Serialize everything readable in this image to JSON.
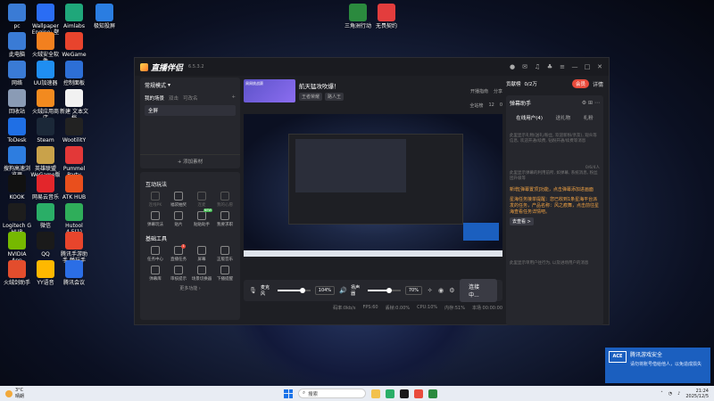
{
  "desktop_icons": [
    {
      "label": "pc",
      "color": "#3a7bd5"
    },
    {
      "label": "此电脑",
      "color": "#3a7bd5"
    },
    {
      "label": "网络",
      "color": "#3a7bd5"
    },
    {
      "label": "回收站",
      "color": "#8a9bb5"
    },
    {
      "label": "ToDesk",
      "color": "#1f6fe5"
    },
    {
      "label": "搜狗高速浏览器",
      "color": "#2d7de0"
    },
    {
      "label": "KOOK",
      "color": "#111111"
    },
    {
      "label": "Logitech G HUB",
      "color": "#1d1d1d"
    },
    {
      "label": "NVIDIA App",
      "color": "#76b900"
    },
    {
      "label": "火绒剑助手",
      "color": "#e34d2d"
    },
    {
      "label": "Wallpaper Engine: 壁纸引擎",
      "color": "#2a6df4"
    },
    {
      "label": "火绒安全软件",
      "color": "#f2801f"
    },
    {
      "label": "UU加速器",
      "color": "#1f8ef1"
    },
    {
      "label": "火绒应用商店",
      "color": "#f28a1f"
    },
    {
      "label": "Steam",
      "color": "#1b2838"
    },
    {
      "label": "英雄联盟 WeGame版",
      "color": "#c9a24a"
    },
    {
      "label": "网易云音乐",
      "color": "#e3262b"
    },
    {
      "label": "微信",
      "color": "#2aae67"
    },
    {
      "label": "QQ",
      "color": "#1a1a1a"
    },
    {
      "label": "YY语音",
      "color": "#ffb800"
    },
    {
      "label": "Aimlabs",
      "color": "#1fa77a"
    },
    {
      "label": "WeGame",
      "color": "#e8442d"
    },
    {
      "label": "控制面板",
      "color": "#2d6fd6"
    },
    {
      "label": "新建 文本文档",
      "color": "#f1f1f1"
    },
    {
      "label": "WootilitY",
      "color": "#222222"
    },
    {
      "label": "Pummel Party",
      "color": "#e33838"
    },
    {
      "label": "ATK HUB",
      "color": "#e94f1d"
    },
    {
      "label": "Hutool 4.5(1)",
      "color": "#2fae5a"
    },
    {
      "label": "腾讯手游助手 畅玩手机...",
      "color": "#e8452c"
    },
    {
      "label": "腾讯会议",
      "color": "#2b6ee6"
    },
    {
      "label": "极知投屏",
      "color": "#2a7de1"
    },
    {
      "label": "三角洲行动",
      "color": "#2b8a3e"
    },
    {
      "label": "无畏契约",
      "color": "#e33d3d"
    }
  ],
  "app": {
    "title": "直播伴侣",
    "version": "6.5.3.2",
    "vip_label": "会员",
    "details_label": "详情",
    "left": {
      "mode_label": "常规模式",
      "horizontal": "横屏",
      "vertical": "竖屏",
      "tabs": [
        "我的场景",
        "双击",
        "可改名"
      ],
      "scene": "全屏",
      "add_source": "添加素材",
      "interact_title": "互动玩法",
      "interact_items": [
        {
          "label": "连线PK",
          "dim": true
        },
        {
          "label": "福袋抽奖",
          "dim": false
        },
        {
          "label": "连麦",
          "dim": true
        },
        {
          "label": "我的心愿",
          "dim": true
        },
        {
          "label": "弹幕玩法",
          "dim": false
        },
        {
          "label": "贴片",
          "dim": false
        },
        {
          "label": "贴贴助手",
          "dim": false,
          "badge": "NEW"
        },
        {
          "label": "我要求职",
          "dim": false
        }
      ],
      "tools_title": "基础工具",
      "tool_items": [
        {
          "label": "任务中心",
          "badge": ""
        },
        {
          "label": "直播任务",
          "badge": "1"
        },
        {
          "label": "屏幕",
          "badge": ""
        },
        {
          "label": "正版音乐",
          "badge": ""
        },
        {
          "label": "弹幕库",
          "badge": ""
        },
        {
          "label": "审核提示",
          "badge": ""
        },
        {
          "label": "场景切换器",
          "badge": ""
        },
        {
          "label": "下播提醒",
          "badge": ""
        }
      ],
      "more": "更多功能"
    },
    "center": {
      "banner_img_text": "周周挑战赛",
      "banner_title": "航天猛攻吹爆！",
      "tags": [
        "王者荣耀",
        "路人王"
      ],
      "actions": [
        "开播指南",
        "分享"
      ],
      "stats": [
        "全站榜",
        "12",
        "0"
      ],
      "mic_label": "麦克风",
      "mic_pct": "104%",
      "speaker_label": "扬声器",
      "speaker_pct": "70%",
      "mic_level": 0.7,
      "speaker_level": 0.6,
      "tool_labels": [
        "美颜",
        "录制",
        "设置"
      ],
      "connect": "连接中...",
      "status": [
        "码率:0kb/s",
        "FPS:60",
        "丢帧:0.00%",
        "CPU:10%",
        "内存:51%",
        "本场 00:00:00"
      ]
    },
    "right": {
      "account": "贡献榜",
      "fans": "0/2万",
      "pay_label": "打赏",
      "danmu_title": "弹幕助手",
      "danmu_tabs": [
        "在线用户(4)",
        "送礼物",
        "礼粉"
      ],
      "danmu_hint1": "此里显示礼物(送礼/粉丝, 欢迎新粉/亲友), 观众等信息, 欢迎开通/续费, 钻粉开通/续费等消息",
      "danmu_hint2": "此里显示弹幕的利用前所, 如弹幕, 系统消息, 粉丝团升级等",
      "notice": "新增[弹幕置顶]功能，点击弹幕添加进画面",
      "notice2": "星海任务接单提醒：您已收到1条星海平台派发的任务，产品名称：风之痕舞，点击前往星海查看任务详情吧。",
      "notice_link": "去查看 >",
      "danmu_hint3": "此里显示单用户往行为, 以及进场用户的消息",
      "count_label": "0/6/4人"
    }
  },
  "toast": {
    "brand": "ACE",
    "title": "腾讯游戏安全",
    "text": "请勿将账号借给他人，以免造成损失"
  },
  "taskbar": {
    "weather_temp": "3°C",
    "weather_text": "晴朗",
    "search": "搜索",
    "time": "21:24",
    "date": "2025/12/5"
  }
}
